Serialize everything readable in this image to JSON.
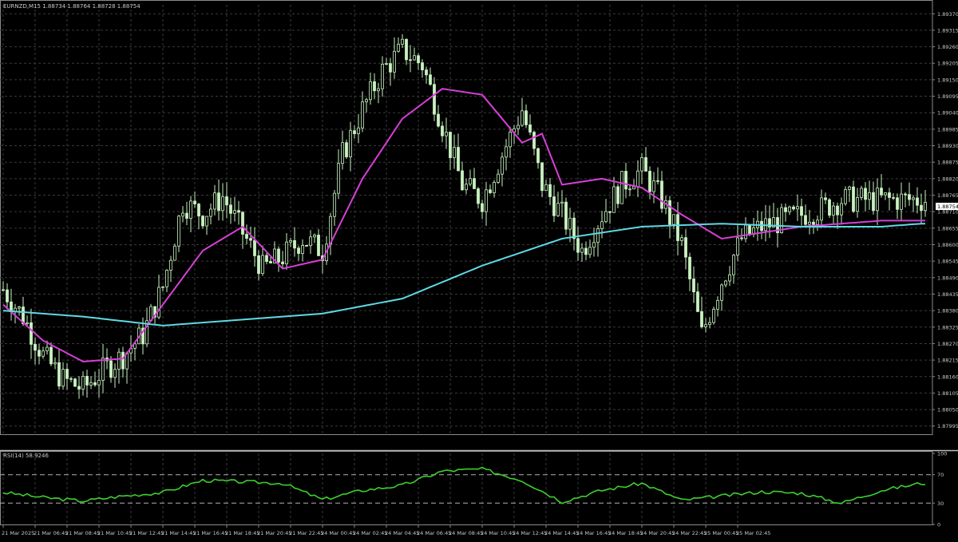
{
  "symbol_header": "EURNZD,M15  1.88734 1.88764 1.88728 1.88754",
  "rsi_header": "RSI(14) 58.9246",
  "current_price_label": "1.88754",
  "colors": {
    "background": "#000000",
    "grid": "#3a3a3a",
    "axis_text": "#c8c8c8",
    "candle": "#c8f2c0",
    "ma_fast": "#d63fd6",
    "ma_slow": "#5fd9e6",
    "rsi": "#3ccf2e",
    "rsi_levels": "#b0b0b0"
  },
  "chart_data": [
    {
      "type": "line",
      "title": "",
      "price_ticks": [
        "1.89370",
        "1.89315",
        "1.89260",
        "1.89205",
        "1.89150",
        "1.89095",
        "1.89040",
        "1.88985",
        "1.88930",
        "1.88875",
        "1.88820",
        "1.88765",
        "1.88710",
        "1.88655",
        "1.88600",
        "1.88545",
        "1.88490",
        "1.88435",
        "1.88380",
        "1.88325",
        "1.88270",
        "1.88215",
        "1.88160",
        "1.88105",
        "1.88050",
        "1.87995"
      ],
      "ylim": [
        1.87965,
        1.894
      ],
      "time_labels": [
        "21 Mar 2025",
        "21 Mar 06:45",
        "21 Mar 08:45",
        "21 Mar 10:45",
        "21 Mar 12:45",
        "21 Mar 14:45",
        "21 Mar 16:45",
        "21 Mar 18:45",
        "21 Mar 20:45",
        "21 Mar 22:45",
        "24 Mar 00:45",
        "24 Mar 02:45",
        "24 Mar 04:45",
        "24 Mar 06:45",
        "24 Mar 08:45",
        "24 Mar 10:45",
        "24 Mar 12:45",
        "24 Mar 14:45",
        "24 Mar 16:45",
        "24 Mar 18:45",
        "24 Mar 20:45",
        "24 Mar 22:45",
        "25 Mar 00:45",
        "25 Mar 02:45"
      ],
      "close_series": {
        "name": "",
        "x_index": [
          0,
          5,
          10,
          15,
          20,
          25,
          30,
          35,
          40,
          45,
          50,
          55,
          60,
          65,
          70,
          75,
          80,
          85,
          90,
          95,
          100,
          105,
          110,
          115,
          120,
          125,
          130,
          135,
          140,
          145,
          150,
          155,
          160,
          165,
          170,
          175,
          180,
          185,
          190,
          195,
          200,
          205,
          210,
          215,
          220,
          225,
          230
        ],
        "values": [
          1.8845,
          1.8836,
          1.8823,
          1.8815,
          1.8812,
          1.8818,
          1.8823,
          1.883,
          1.8846,
          1.8874,
          1.887,
          1.8876,
          1.8864,
          1.8852,
          1.8856,
          1.8862,
          1.8858,
          1.889,
          1.8905,
          1.8918,
          1.8925,
          1.892,
          1.89,
          1.888,
          1.8875,
          1.889,
          1.8905,
          1.888,
          1.887,
          1.8858,
          1.887,
          1.888,
          1.8885,
          1.8875,
          1.886,
          1.883,
          1.8848,
          1.8862,
          1.8866,
          1.8868,
          1.887,
          1.8872,
          1.8875,
          1.8875,
          1.8875,
          1.8875,
          1.8875
        ]
      },
      "series": [
        {
          "name": "",
          "x_index": [
            0,
            10,
            20,
            30,
            40,
            50,
            60,
            70,
            80,
            90,
            100,
            110,
            120,
            130,
            135,
            140,
            150,
            160,
            170,
            180,
            190,
            200,
            210,
            220,
            230
          ],
          "values": [
            1.884,
            1.8828,
            1.8821,
            1.8822,
            1.884,
            1.8858,
            1.8866,
            1.8852,
            1.8855,
            1.8882,
            1.8902,
            1.8912,
            1.891,
            1.8894,
            1.8897,
            1.888,
            1.8882,
            1.8879,
            1.887,
            1.8862,
            1.8864,
            1.8866,
            1.8867,
            1.8868,
            1.8868
          ]
        },
        {
          "name": "",
          "x_index": [
            0,
            20,
            40,
            60,
            80,
            100,
            120,
            140,
            160,
            180,
            200,
            220,
            230
          ],
          "values": [
            1.8838,
            1.8836,
            1.8833,
            1.8835,
            1.8837,
            1.8842,
            1.8853,
            1.8862,
            1.8866,
            1.8867,
            1.8866,
            1.8866,
            1.8867
          ]
        }
      ]
    },
    {
      "type": "line",
      "title": "",
      "ylim": [
        0,
        100
      ],
      "y_ticks": [
        "100",
        "70",
        "30",
        "0"
      ],
      "levels": [
        70,
        30
      ],
      "series": [
        {
          "name": "",
          "x_index": [
            0,
            10,
            20,
            30,
            40,
            50,
            60,
            70,
            80,
            90,
            100,
            110,
            120,
            130,
            140,
            150,
            160,
            170,
            180,
            190,
            200,
            210,
            220,
            230
          ],
          "values": [
            45,
            38,
            33,
            40,
            45,
            62,
            60,
            58,
            35,
            48,
            55,
            75,
            78,
            62,
            32,
            48,
            58,
            34,
            40,
            46,
            44,
            30,
            48,
            58
          ]
        }
      ]
    }
  ]
}
